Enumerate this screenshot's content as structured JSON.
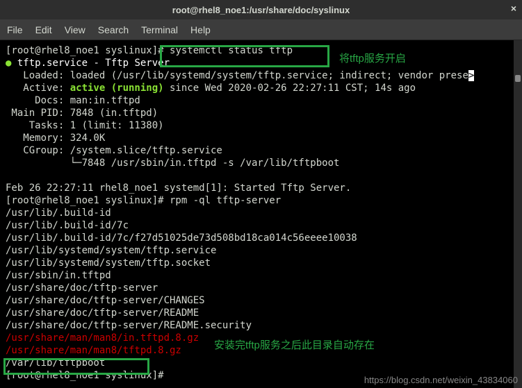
{
  "window": {
    "title": "root@rhel8_noe1:/usr/share/doc/syslinux",
    "close": "×"
  },
  "menu": {
    "file": "File",
    "edit": "Edit",
    "view": "View",
    "search": "Search",
    "terminal": "Terminal",
    "help": "Help"
  },
  "term": {
    "prompt1": "[root@rhel8_noe1 syslinux]# ",
    "cmd1": "systemctl status tftp",
    "dot": "●",
    "svc_line": " tftp.service - Tftp Server",
    "loaded": "   Loaded: loaded (/usr/lib/systemd/system/tftp.service; indirect; vendor prese",
    "active_pre": "   Active: ",
    "active_status": "active (running)",
    "active_post": " since Wed 2020-02-26 22:27:11 CST; 14s ago",
    "docs": "     Docs: man:in.tftpd",
    "pid": " Main PID: 7848 (in.tftpd)",
    "tasks": "    Tasks: 1 (limit: 11380)",
    "memory": "   Memory: 324.0K",
    "cgroup": "   CGroup: /system.slice/tftp.service",
    "cgroup2": "           └─7848 /usr/sbin/in.tftpd -s /var/lib/tftpboot",
    "log1": "Feb 26 22:27:11 rhel8_noe1 systemd[1]: Started Tftp Server.",
    "prompt2": "[root@rhel8_noe1 syslinux]# rpm -ql tftp-server",
    "l1": "/usr/lib/.build-id",
    "l2": "/usr/lib/.build-id/7c",
    "l3": "/usr/lib/.build-id/7c/f27d51025de73d508bd18ca014c56eeee10038",
    "l4": "/usr/lib/systemd/system/tftp.service",
    "l5": "/usr/lib/systemd/system/tftp.socket",
    "l6": "/usr/sbin/in.tftpd",
    "l7": "/usr/share/doc/tftp-server",
    "l8": "/usr/share/doc/tftp-server/CHANGES",
    "l9": "/usr/share/doc/tftp-server/README",
    "l10": "/usr/share/doc/tftp-server/README.security",
    "l11": "/usr/share/man/man8/in.tftpd.8.gz",
    "l12": "/usr/share/man/man8/tftpd.8.gz",
    "l13": "/var/lib/tftpboot",
    "prompt3": "[root@rhel8_noe1 syslinux]#"
  },
  "annotations": {
    "a1": "将tftp服务开启",
    "a2": "安装完tftp服务之后此目录自动存在"
  },
  "watermark": "https://blog.csdn.net/weixin_43834060"
}
